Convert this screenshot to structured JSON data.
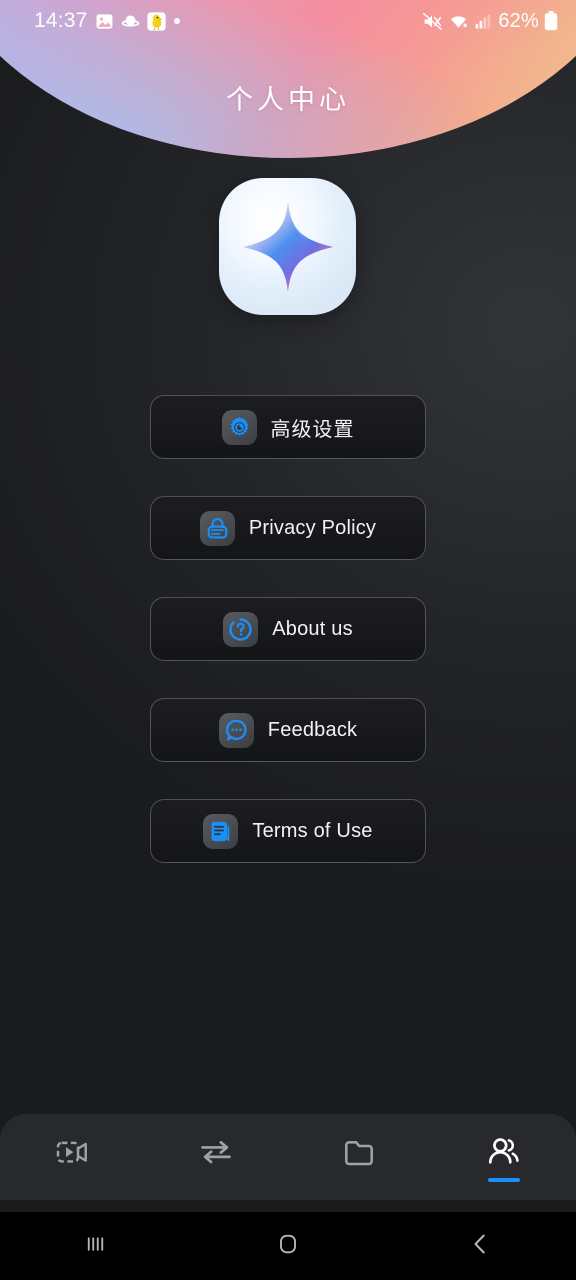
{
  "status_bar": {
    "clock": "14:37",
    "battery_percent": "62%",
    "left_icons": [
      "photo-icon",
      "planet-icon",
      "chick-icon",
      "dot-icon"
    ],
    "right_icons": [
      "mute-icon",
      "wifi-icon",
      "cellular-signal-icon",
      "battery-icon"
    ]
  },
  "header": {
    "title": "个人中心",
    "gradient_from": "#a9c8f2",
    "gradient_to": "#f4c79a",
    "logo_icon": "sparkle-star-icon"
  },
  "menu": {
    "items": [
      {
        "label": "高级设置",
        "icon": "gear-icon",
        "name": "advanced-settings"
      },
      {
        "label": "Privacy Policy",
        "icon": "lock-icon",
        "name": "privacy-policy"
      },
      {
        "label": "About us",
        "icon": "question-icon",
        "name": "about-us"
      },
      {
        "label": "Feedback",
        "icon": "chat-icon",
        "name": "feedback"
      },
      {
        "label": "Terms of Use",
        "icon": "document-icon",
        "name": "terms-of-use"
      }
    ],
    "icon_accent": "#1b8ff5"
  },
  "tab_bar": {
    "active_index": 3,
    "active_color": "#1b8ff5",
    "inactive_color": "#9ea2a8",
    "items": [
      {
        "icon": "video-camera-icon",
        "name": "tab-record"
      },
      {
        "icon": "transfer-arrows-icon",
        "name": "tab-transfer"
      },
      {
        "icon": "folder-icon",
        "name": "tab-files"
      },
      {
        "icon": "users-icon",
        "name": "tab-profile"
      }
    ]
  },
  "android_nav": {
    "items": [
      {
        "icon": "recents-icon",
        "name": "nav-recents"
      },
      {
        "icon": "home-icon",
        "name": "nav-home"
      },
      {
        "icon": "back-icon",
        "name": "nav-back"
      }
    ]
  }
}
